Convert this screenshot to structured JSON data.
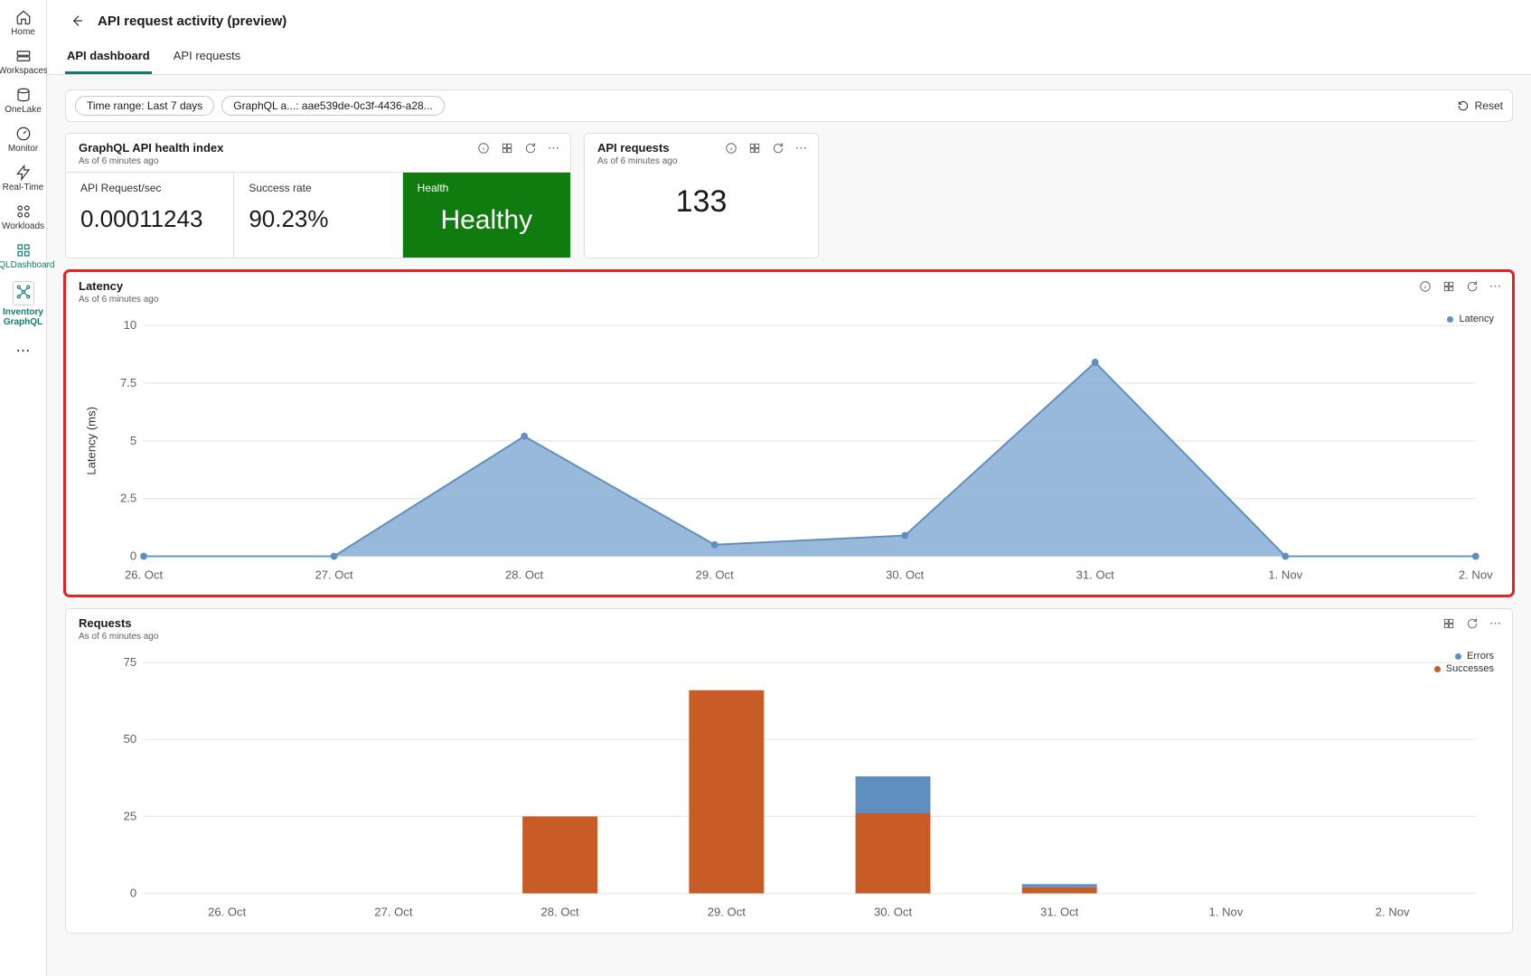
{
  "sidebar": {
    "items": [
      {
        "label": "Home",
        "icon": "home"
      },
      {
        "label": "Workspaces",
        "icon": "workspaces"
      },
      {
        "label": "OneLake",
        "icon": "onelake"
      },
      {
        "label": "Monitor",
        "icon": "monitor"
      },
      {
        "label": "Real-Time",
        "icon": "realtime"
      },
      {
        "label": "Workloads",
        "icon": "workloads"
      },
      {
        "label": "GQLDashboard",
        "icon": "gql"
      },
      {
        "label": "Inventory GraphQL",
        "icon": "inventory"
      }
    ]
  },
  "header": {
    "title": "API request activity (preview)",
    "tabs": [
      {
        "label": "API dashboard",
        "active": true
      },
      {
        "label": "API requests",
        "active": false
      }
    ]
  },
  "filters": {
    "time_range": "Time range: Last 7 days",
    "graphql_filter": "GraphQL a...: aae539de-0c3f-4436-a28...",
    "reset": "Reset"
  },
  "cards": {
    "health_index": {
      "title": "GraphQL API health index",
      "sub": "As of 6 minutes ago",
      "metrics": {
        "rps_label": "API Request/sec",
        "rps_value": "0.00011243",
        "success_label": "Success rate",
        "success_value": "90.23%",
        "health_label": "Health",
        "health_value": "Healthy"
      }
    },
    "api_requests": {
      "title": "API requests",
      "sub": "As of 6 minutes ago",
      "value": "133"
    },
    "latency": {
      "title": "Latency",
      "sub": "As of 6 minutes ago",
      "legend_label": "Latency",
      "ylabel": "Latency (ms)"
    },
    "requests": {
      "title": "Requests",
      "sub": "As of 6 minutes ago",
      "legend_errors": "Errors",
      "legend_successes": "Successes"
    }
  },
  "chart_data": [
    {
      "type": "area",
      "title": "Latency",
      "xlabel": "",
      "ylabel": "Latency (ms)",
      "ylim": [
        0,
        10
      ],
      "y_ticks": [
        0,
        2.5,
        5,
        7.5,
        10
      ],
      "categories": [
        "26. Oct",
        "27. Oct",
        "28. Oct",
        "29. Oct",
        "30. Oct",
        "31. Oct",
        "1. Nov",
        "2. Nov"
      ],
      "series": [
        {
          "name": "Latency",
          "values": [
            0,
            0,
            5.2,
            0.5,
            0.9,
            8.4,
            0,
            0
          ]
        }
      ],
      "legend_position": "right"
    },
    {
      "type": "bar",
      "title": "Requests",
      "xlabel": "",
      "ylabel": "",
      "ylim": [
        0,
        75
      ],
      "y_ticks": [
        0,
        25,
        50,
        75
      ],
      "categories": [
        "26. Oct",
        "27. Oct",
        "28. Oct",
        "29. Oct",
        "30. Oct",
        "31. Oct",
        "1. Nov",
        "2. Nov"
      ],
      "series": [
        {
          "name": "Successes",
          "color": "#c85c27",
          "values": [
            0,
            0,
            25,
            66,
            26,
            2,
            0,
            0
          ]
        },
        {
          "name": "Errors",
          "color": "#5f8ec0",
          "values": [
            0,
            0,
            0,
            0,
            12,
            1,
            0,
            0
          ]
        }
      ],
      "stacked": true,
      "legend_position": "right"
    }
  ]
}
